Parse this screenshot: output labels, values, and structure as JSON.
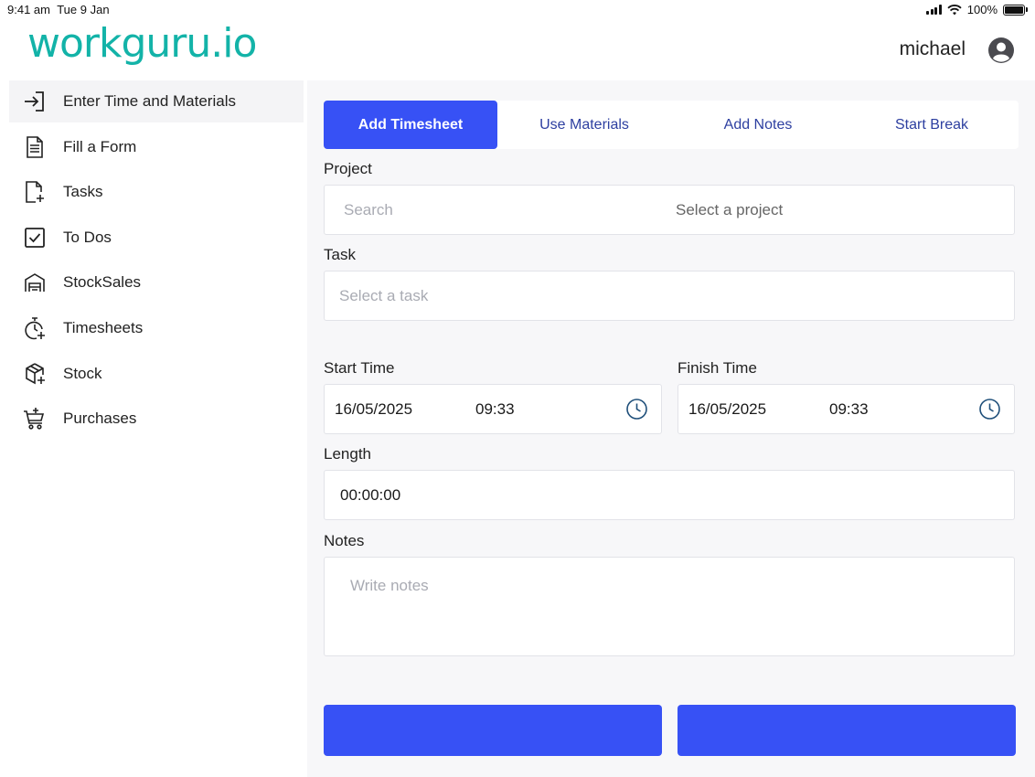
{
  "status": {
    "time": "9:41 am",
    "date": "Tue 9 Jan",
    "battery": "100%"
  },
  "header": {
    "logo": "workguru.io",
    "username": "michael"
  },
  "sidebar": {
    "items": [
      {
        "label": "Enter Time and Materials",
        "icon": "enter-icon"
      },
      {
        "label": "Fill a Form",
        "icon": "form-icon"
      },
      {
        "label": "Tasks",
        "icon": "task-add-icon"
      },
      {
        "label": "To Dos",
        "icon": "checkbox-icon"
      },
      {
        "label": "StockSales",
        "icon": "store-icon"
      },
      {
        "label": "Timesheets",
        "icon": "stopwatch-icon"
      },
      {
        "label": "Stock",
        "icon": "package-icon"
      },
      {
        "label": "Purchases",
        "icon": "cart-icon"
      }
    ]
  },
  "tabs": [
    "Add Timesheet",
    "Use Materials",
    "Add Notes",
    "Start Break"
  ],
  "form": {
    "project_label": "Project",
    "project_search_placeholder": "Search",
    "project_select": "Select a project",
    "task_label": "Task",
    "task_placeholder": "Select a task",
    "start_label": "Start Time",
    "start_date": "16/05/2025",
    "start_time": "09:33",
    "finish_label": "Finish Time",
    "finish_date": "16/05/2025",
    "finish_time": "09:33",
    "length_label": "Length",
    "length_value": "00:00:00",
    "notes_label": "Notes",
    "notes_placeholder": "Write notes"
  },
  "colors": {
    "accent": "#3751f5",
    "brand": "#13b3a8"
  }
}
